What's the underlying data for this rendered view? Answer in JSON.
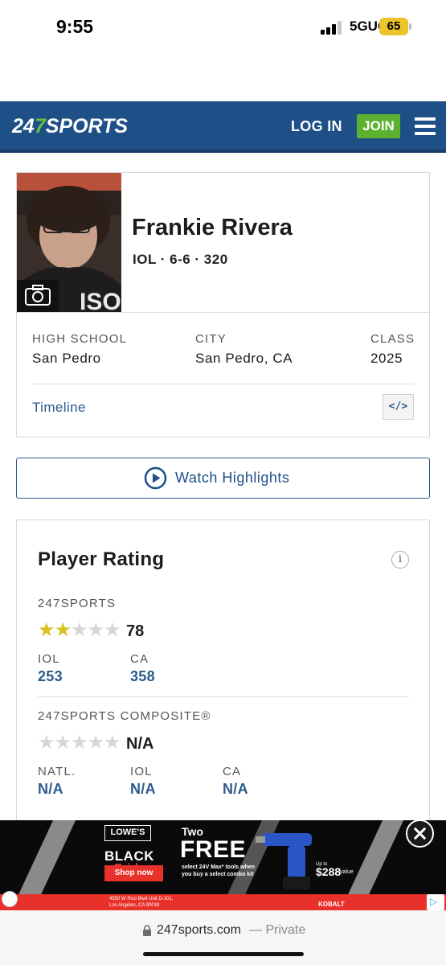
{
  "status_bar": {
    "time": "9:55",
    "network": "5GUC",
    "battery": "65",
    "battery_color": "#ecc42a"
  },
  "header": {
    "logo_prefix": "24",
    "logo_seven": "7",
    "logo_suffix": "SPORTS",
    "login_label": "LOG IN",
    "join_label": "JOIN",
    "menu_icon": "hamburger-icon",
    "brand_color": "#1e4f87",
    "join_color": "#5cb130"
  },
  "player": {
    "name": "Frankie Rivera",
    "meta": "IOL · 6-6 · 320",
    "photo_icon": "camera-icon",
    "high_school_label": "HIGH SCHOOL",
    "high_school": "San Pedro",
    "city_label": "CITY",
    "city": "San Pedro, CA",
    "class_label": "CLASS",
    "class_year": "2025",
    "timeline_label": "Timeline",
    "embed_label": "</>"
  },
  "highlights": {
    "label": "Watch Highlights",
    "icon": "play-circle-icon"
  },
  "rating": {
    "title": "Player Rating",
    "info_icon": "i",
    "sports247": {
      "label": "247SPORTS",
      "stars_filled": 2,
      "stars_total": 5,
      "score": "78",
      "ranks": [
        {
          "label": "IOL",
          "value": "253"
        },
        {
          "label": "CA",
          "value": "358"
        }
      ]
    },
    "composite": {
      "label": "247SPORTS COMPOSITE®",
      "stars_filled": 0,
      "stars_total": 5,
      "score": "N/A",
      "ranks": [
        {
          "label": "NATL.",
          "value": "N/A"
        },
        {
          "label": "IOL",
          "value": "N/A"
        },
        {
          "label": "CA",
          "value": "N/A"
        }
      ]
    },
    "star_on_color": "#d8c21f",
    "star_off_color": "#d6d6d6"
  },
  "ad": {
    "lowes": "LOWE'S",
    "black": "BLACK",
    "friday": "Friday",
    "shop": "Shop now",
    "two": "Two",
    "free": "FREE",
    "fine_print": "select 24V Max* tools when you buy a select combo kit",
    "up_to": "Up to",
    "price": "$288",
    "value_label": "value",
    "address_line1": "4550 W Pico Blvd Unit D-101,",
    "address_line2": "Los Angeles, CA 90019",
    "brand": "KOBALT",
    "close_icon": "close-icon",
    "adchoices_icon": "adchoices-icon"
  },
  "browser": {
    "url": "247sports.com",
    "privacy": "— Private"
  }
}
